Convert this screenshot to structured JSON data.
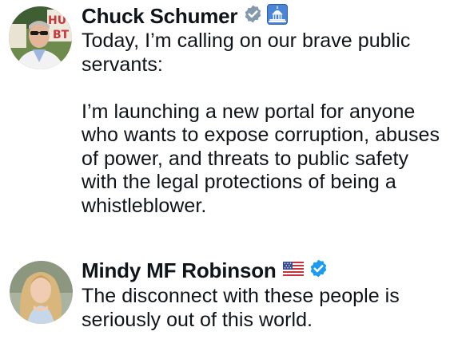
{
  "posts": [
    {
      "display_name": "Chuck Schumer",
      "badges": [
        "verified-gray-icon",
        "us-capitol-icon"
      ],
      "text": "Today, I’m calling on our brave public servants:\n\nI’m launching a new portal for anyone who wants to expose corruption, abuses of power, and threats to public safety with the legal protections of being a whistleblower."
    },
    {
      "display_name": "Mindy MF Robinson",
      "badges": [
        "us-flag-icon",
        "verified-blue-icon"
      ],
      "text": "The disconnect with these people is seriously out of this world."
    }
  ],
  "colors": {
    "text": "#0f1419",
    "verified_gray": "#829aab",
    "verified_blue": "#1d9bf0",
    "capitol_badge_bg": "#4b86d6"
  }
}
